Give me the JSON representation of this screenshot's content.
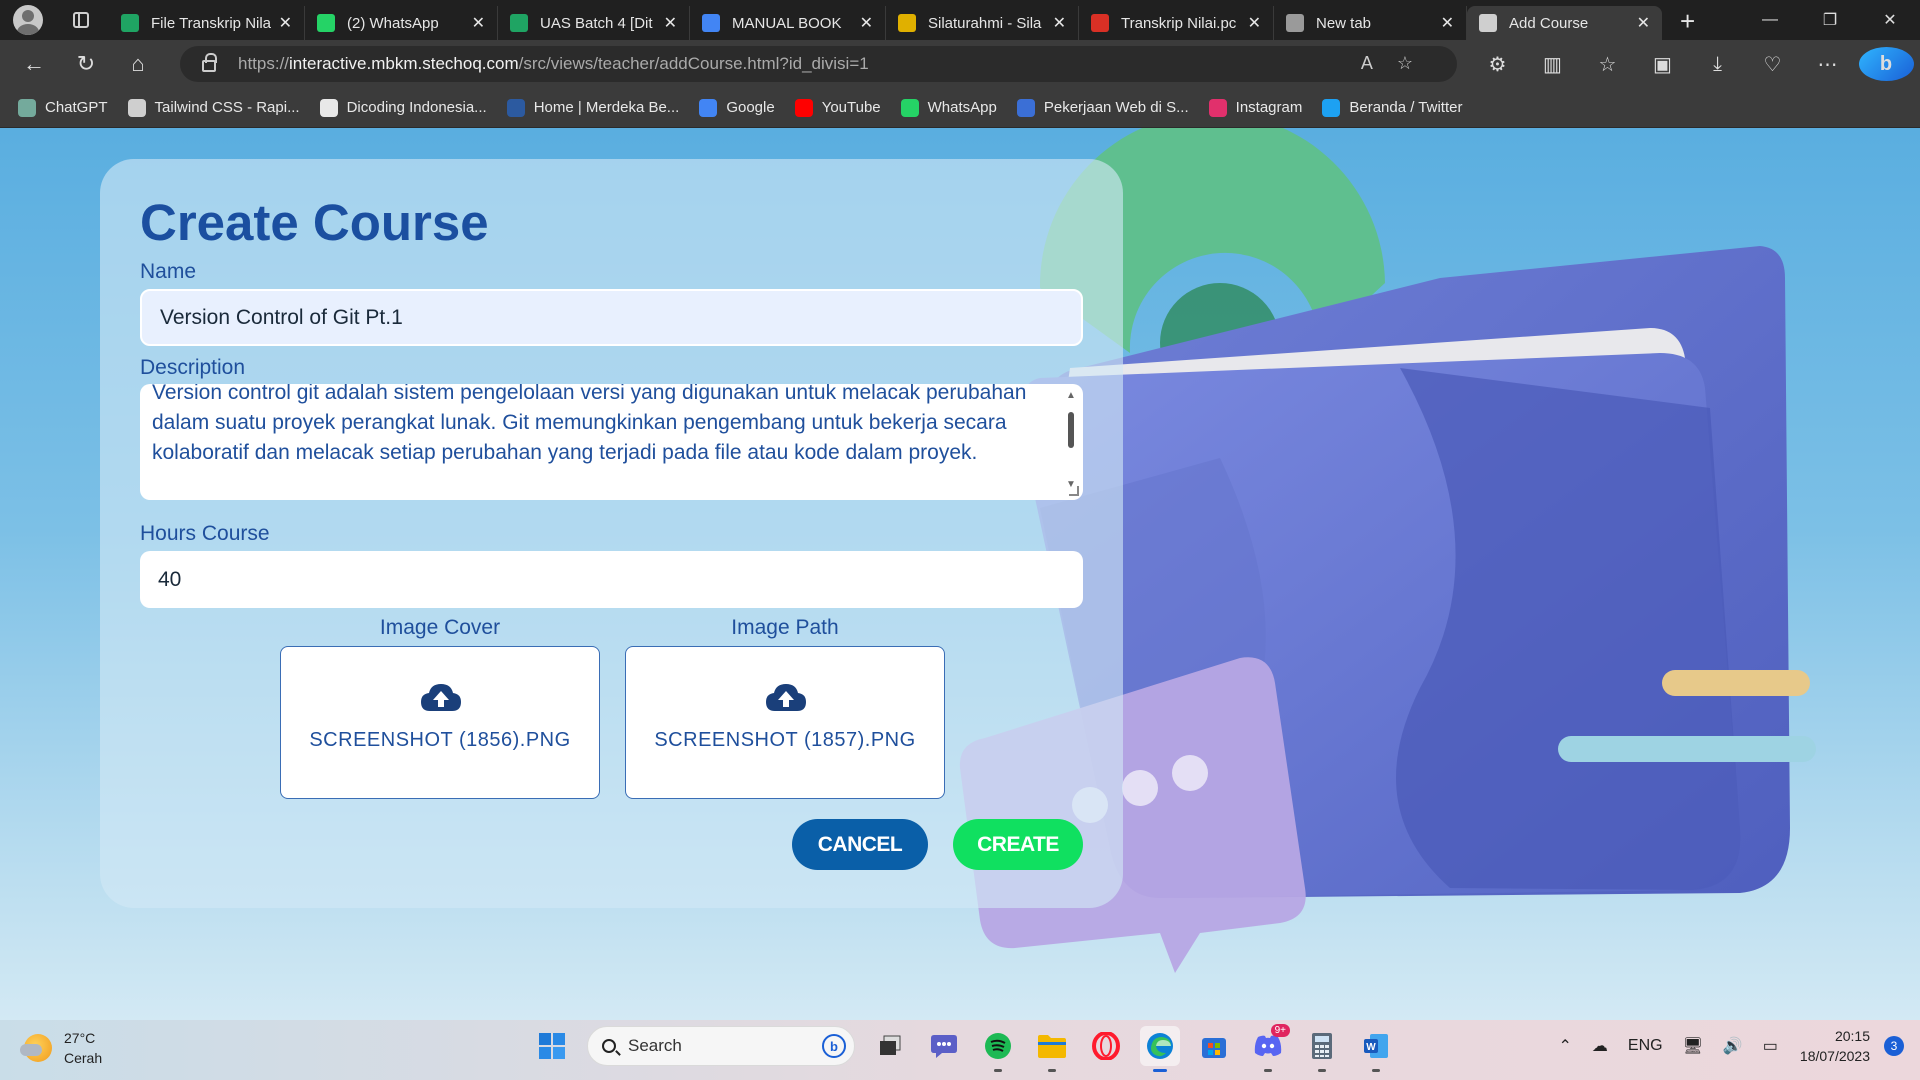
{
  "browser": {
    "tabs": [
      {
        "title": "File Transkrip Nila",
        "favicon": "drive-icon",
        "color": "#1fa463"
      },
      {
        "title": "(2) WhatsApp",
        "favicon": "whatsapp-icon",
        "color": "#25d366"
      },
      {
        "title": "UAS Batch 4 [Dit",
        "favicon": "drive-icon",
        "color": "#1fa463"
      },
      {
        "title": "MANUAL BOOK",
        "favicon": "docs-icon",
        "color": "#4285f4"
      },
      {
        "title": "Silaturahmi - Sila",
        "favicon": "seal-icon",
        "color": "#e0b000"
      },
      {
        "title": "Transkrip Nilai.pc",
        "favicon": "pdf-icon",
        "color": "#d93025"
      },
      {
        "title": "New tab",
        "favicon": "newtab-icon",
        "color": "#9a9a9a"
      },
      {
        "title": "Add Course",
        "favicon": "page-icon",
        "color": "#cfcfcf"
      }
    ],
    "url_prefix": "https://",
    "url_host": "interactive.mbkm.stechoq.com",
    "url_path": "/src/views/teacher/addCourse.html?id_divisi=1",
    "bookmarks": [
      {
        "label": "ChatGPT",
        "icon": "chatgpt-icon",
        "color": "#74aa9c"
      },
      {
        "label": "Tailwind CSS - Rapi...",
        "icon": "page-icon",
        "color": "#cfcfcf"
      },
      {
        "label": "Dicoding Indonesia...",
        "icon": "dicoding-icon",
        "color": "#e8e8e8"
      },
      {
        "label": "Home | Merdeka Be...",
        "icon": "merdeka-icon",
        "color": "#2c5aa0"
      },
      {
        "label": "Google",
        "icon": "google-icon",
        "color": "#4285f4"
      },
      {
        "label": "YouTube",
        "icon": "youtube-icon",
        "color": "#ff0000"
      },
      {
        "label": "WhatsApp",
        "icon": "whatsapp-icon",
        "color": "#25d366"
      },
      {
        "label": "Pekerjaan Web di S...",
        "icon": "job-icon",
        "color": "#3b6fd6"
      },
      {
        "label": "Instagram",
        "icon": "instagram-icon",
        "color": "#e1306c"
      },
      {
        "label": "Beranda / Twitter",
        "icon": "twitter-icon",
        "color": "#1da1f2"
      }
    ]
  },
  "form": {
    "title": "Create Course",
    "name_label": "Name",
    "name_value": "Version Control of Git Pt.1",
    "description_label": "Description",
    "description_value": "Version control git adalah sistem pengelolaan versi yang digunakan untuk melacak perubahan dalam suatu proyek perangkat lunak. Git memungkinkan pengembang untuk bekerja secara kolaboratif dan melacak setiap perubahan yang terjadi pada file atau kode dalam proyek.",
    "hours_label": "Hours Course",
    "hours_value": "40",
    "image_cover_label": "Image Cover",
    "image_cover_file": "SCREENSHOT (1856).PNG",
    "image_path_label": "Image Path",
    "image_path_file": "SCREENSHOT (1857).PNG",
    "cancel_label": "CANCEL",
    "create_label": "CREATE",
    "colors": {
      "title": "#1b4fa0",
      "cancel": "#0a5fa8",
      "create": "#10e060"
    }
  },
  "taskbar": {
    "temperature": "27°C",
    "weather": "Cerah",
    "search_placeholder": "Search",
    "language": "ENG",
    "time": "20:15",
    "date": "18/07/2023",
    "notifications": "3",
    "discord_badge": "9+"
  }
}
